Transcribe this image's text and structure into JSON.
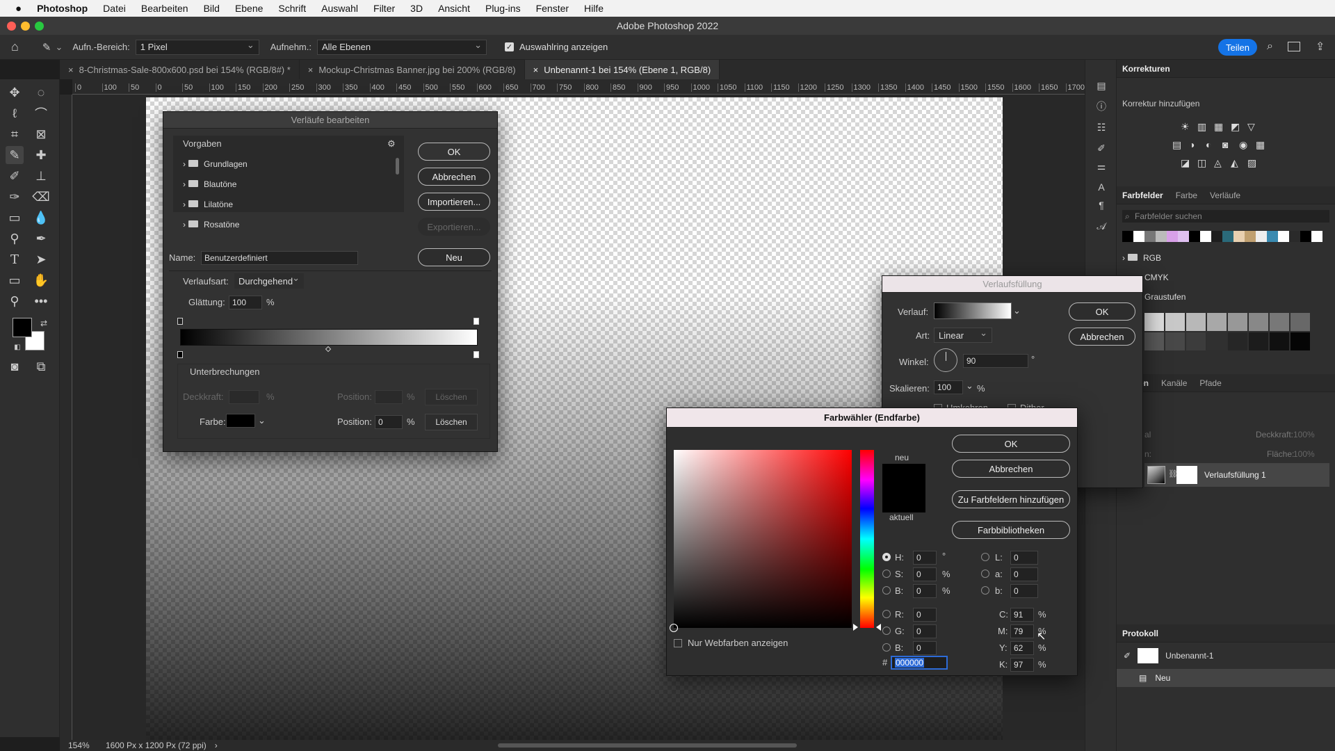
{
  "menubar": {
    "apple": "",
    "app": "Photoshop",
    "items": [
      "Datei",
      "Bearbeiten",
      "Bild",
      "Ebene",
      "Schrift",
      "Auswahl",
      "Filter",
      "3D",
      "Ansicht",
      "Plug-ins",
      "Fenster",
      "Hilfe"
    ]
  },
  "window": {
    "title": "Adobe Photoshop 2022"
  },
  "options": {
    "sample_label": "Aufn.-Bereich:",
    "sample_value": "1 Pixel",
    "layers_label": "Aufnehm.:",
    "layers_value": "Alle Ebenen",
    "ring_label": "Auswahlring anzeigen",
    "share": "Teilen"
  },
  "tabs": [
    {
      "label": "8-Christmas-Sale-800x600.psd bei 154% (RGB/8#) *"
    },
    {
      "label": "Mockup-Christmas Banner.jpg bei 200% (RGB/8)"
    },
    {
      "label": "Unbenannt-1 bei 154% (Ebene 1, RGB/8)"
    }
  ],
  "ruler": {
    "ticks": [
      "0",
      "100",
      "50",
      "0",
      "50",
      "100",
      "150",
      "200",
      "250",
      "300",
      "350",
      "400",
      "450",
      "500",
      "550",
      "600",
      "650",
      "700",
      "750",
      "800",
      "850",
      "900",
      "950",
      "1000",
      "1050",
      "1100",
      "1150",
      "1200",
      "1250",
      "1300",
      "1350",
      "1400",
      "1450",
      "1500",
      "1550",
      "1600",
      "1650",
      "1700"
    ]
  },
  "status": {
    "zoom": "154%",
    "size": "1600 Px x 1200 Px (72 ppi)",
    "arrow": "›"
  },
  "gradient_editor": {
    "title": "Verläufe bearbeiten",
    "presets_label": "Vorgaben",
    "folders": [
      "Grundlagen",
      "Blautöne",
      "Lilatöne",
      "Rosatöne"
    ],
    "ok": "OK",
    "cancel": "Abbrechen",
    "import": "Importieren...",
    "export": "Exportieren...",
    "name_label": "Name:",
    "name_value": "Benutzerdefiniert",
    "new": "Neu",
    "type_label": "Verlaufsart:",
    "type_value": "Durchgehend",
    "smooth_label": "Glättung:",
    "smooth_value": "100",
    "pct": "%",
    "stops_label": "Unterbrechungen",
    "opacity_label": "Deckkraft:",
    "position_label": "Position:",
    "delete": "Löschen",
    "color_label": "Farbe:",
    "position_value": "0"
  },
  "gradient_fill": {
    "title": "Verlaufsfüllung",
    "gradient_label": "Verlauf:",
    "style_label": "Art:",
    "style_value": "Linear",
    "angle_label": "Winkel:",
    "angle_value": "90",
    "deg": "°",
    "scale_label": "Skalieren:",
    "scale_value": "100",
    "pct": "%",
    "ok": "OK",
    "cancel": "Abbrechen",
    "reverse": "Umkehren",
    "dither": "Dither"
  },
  "color_picker": {
    "title": "Farbwähler (Endfarbe)",
    "new": "neu",
    "current": "aktuell",
    "ok": "OK",
    "cancel": "Abbrechen",
    "add_swatch": "Zu Farbfeldern hinzufügen",
    "libraries": "Farbbibliotheken",
    "web_only": "Nur Webfarben anzeigen",
    "H": {
      "label": "H:",
      "value": "0",
      "unit": "°"
    },
    "S": {
      "label": "S:",
      "value": "0",
      "unit": "%"
    },
    "Bv": {
      "label": "B:",
      "value": "0",
      "unit": "%"
    },
    "R": {
      "label": "R:",
      "value": "0"
    },
    "G": {
      "label": "G:",
      "value": "0"
    },
    "Bl": {
      "label": "B:",
      "value": "0"
    },
    "L": {
      "label": "L:",
      "value": "0"
    },
    "a": {
      "label": "a:",
      "value": "0"
    },
    "b": {
      "label": "b:",
      "value": "0"
    },
    "C": {
      "label": "C:",
      "value": "91",
      "unit": "%"
    },
    "M": {
      "label": "M:",
      "value": "79",
      "unit": "%"
    },
    "Y": {
      "label": "Y:",
      "value": "62",
      "unit": "%"
    },
    "K": {
      "label": "K:",
      "value": "97",
      "unit": "%"
    },
    "hash": "#",
    "hex": "000000"
  },
  "panels": {
    "adjustments": {
      "title": "Korrekturen",
      "subtitle": "Korrektur hinzufügen"
    },
    "swatches": {
      "tabs": [
        "Farbfelder",
        "Farbe",
        "Verläufe"
      ],
      "search": "Farbfelder suchen",
      "groups": [
        "RGB",
        "CMYK",
        "Graustufen"
      ]
    },
    "layers": {
      "tabs": [
        "en",
        "Kanäle",
        "Pfade"
      ],
      "kind": "al",
      "opacity_label": "Deckkraft:",
      "opacity_value": "100%",
      "lock_label": "n:",
      "fill_label": "Fläche:",
      "fill_value": "100%",
      "layer_name": "Verlaufsfüllung 1"
    },
    "history": {
      "title": "Protokoll",
      "items": [
        "Unbenannt-1",
        "Neu"
      ]
    }
  },
  "colors": {
    "accent": "#1473e6",
    "selection": "#2d6bd8"
  }
}
